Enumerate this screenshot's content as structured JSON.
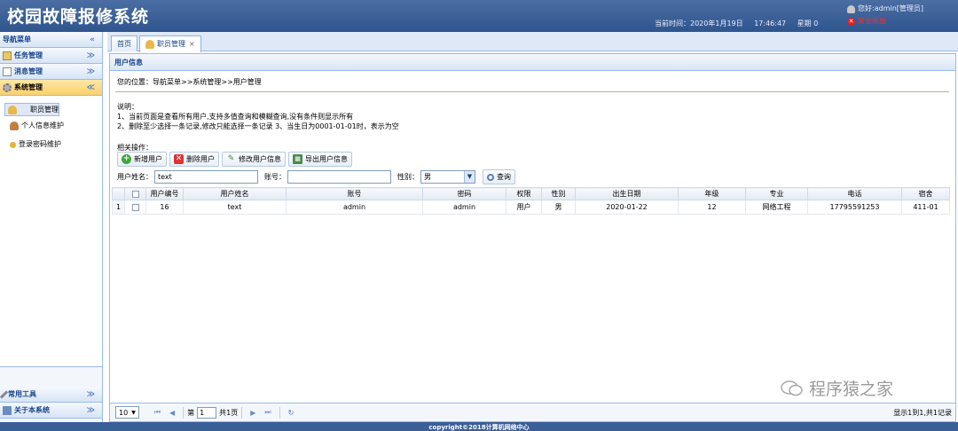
{
  "header": {
    "title": "校园故障报修系统",
    "datetime_label": "当前时间：2020年1月19日",
    "time": "17:46:47",
    "weekday": "星期 0",
    "user_greeting": "您好:admin[管理员]",
    "logout": "安全退出"
  },
  "sidebar": {
    "title": "导航菜单",
    "sections": [
      {
        "label": "任务管理"
      },
      {
        "label": "消息管理"
      },
      {
        "label": "系统管理"
      }
    ],
    "items": [
      {
        "label": "职员管理"
      },
      {
        "label": "个人信息维护"
      },
      {
        "label": "登录密码维护"
      }
    ],
    "bottom": [
      {
        "label": "常用工具"
      },
      {
        "label": "关于本系统"
      }
    ]
  },
  "tabs": [
    {
      "label": "首页"
    },
    {
      "label": "职员管理"
    }
  ],
  "panel": {
    "title": "用户信息",
    "location": "您的位置：导航菜单>>系统管理>>用户管理",
    "notes_title": "说明：",
    "note1": "1、当前页面是查看所有用户,支持多值查询和模糊查询,没有条件则显示所有",
    "note2": "2、删除至少选择一条记录,修改只能选择一条记录 3、当生日为0001-01-01时，表示为空",
    "ops_label": "相关操作：",
    "buttons": {
      "add": "新增用户",
      "delete": "删除用户",
      "edit": "修改用户信息",
      "export": "导出用户信息"
    },
    "search": {
      "name_label": "用户姓名：",
      "name_value": "text",
      "account_label": "账号：",
      "account_value": "",
      "gender_label": "性别：",
      "gender_value": "男",
      "query": "查询"
    }
  },
  "table": {
    "columns": [
      "用户编号",
      "用户姓名",
      "账号",
      "密码",
      "权限",
      "性别",
      "出生日期",
      "年级",
      "专业",
      "电话",
      "宿舍"
    ],
    "rows": [
      {
        "rownum": "1",
        "cells": [
          "16",
          "text",
          "admin",
          "admin",
          "用户",
          "男",
          "2020-01-22",
          "12",
          "网络工程",
          "17795591253",
          "411-01"
        ]
      }
    ]
  },
  "pager": {
    "page_size": "10",
    "page_label": "第",
    "page_value": "1",
    "total_pages": "共1页",
    "info": "显示1到1,共1记录"
  },
  "watermark": "程序猿之家",
  "footer": "copyright©2018计算机网络中心"
}
